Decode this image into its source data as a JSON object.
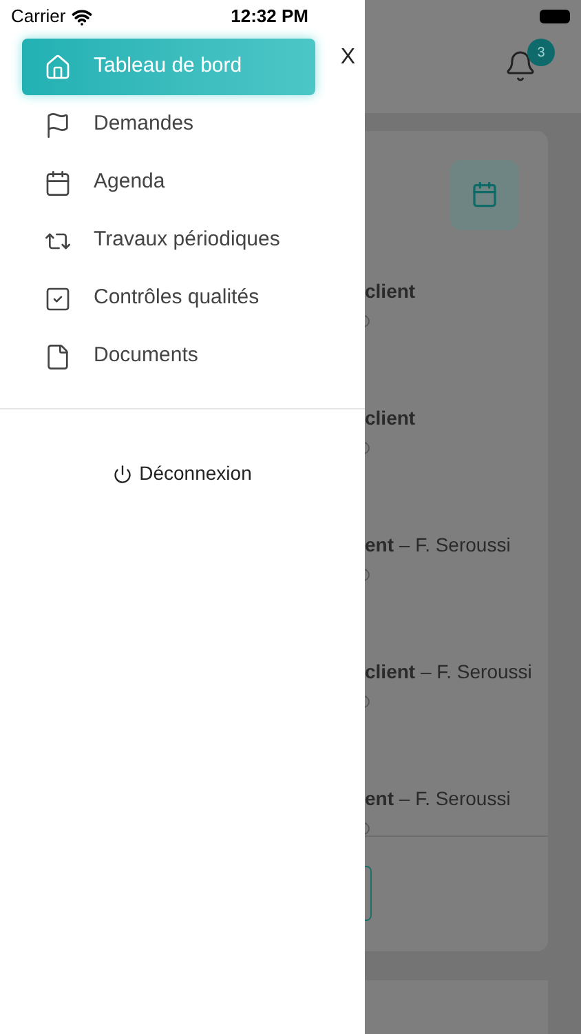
{
  "status_bar": {
    "carrier": "Carrier",
    "time": "12:32 PM"
  },
  "drawer": {
    "close": "X",
    "items": [
      {
        "kind": "home",
        "label": "Tableau de bord",
        "selected": true
      },
      {
        "kind": "flag",
        "label": "Demandes",
        "selected": false
      },
      {
        "kind": "calendar",
        "label": "Agenda",
        "selected": false
      },
      {
        "kind": "repeat",
        "label": "Travaux périodiques",
        "selected": false
      },
      {
        "kind": "check",
        "label": "Contrôles qualités",
        "selected": false
      },
      {
        "kind": "file",
        "label": "Documents",
        "selected": false
      }
    ],
    "logout": "Déconnexion"
  },
  "background": {
    "notification_count": "3",
    "rows": [
      {
        "title": "**client**"
      },
      {
        "title": "**client**"
      },
      {
        "title": "**ent** – F. Seroussi"
      },
      {
        "title": "**client** – F. Seroussi"
      },
      {
        "title": "**ent** – F. Seroussi"
      }
    ]
  }
}
